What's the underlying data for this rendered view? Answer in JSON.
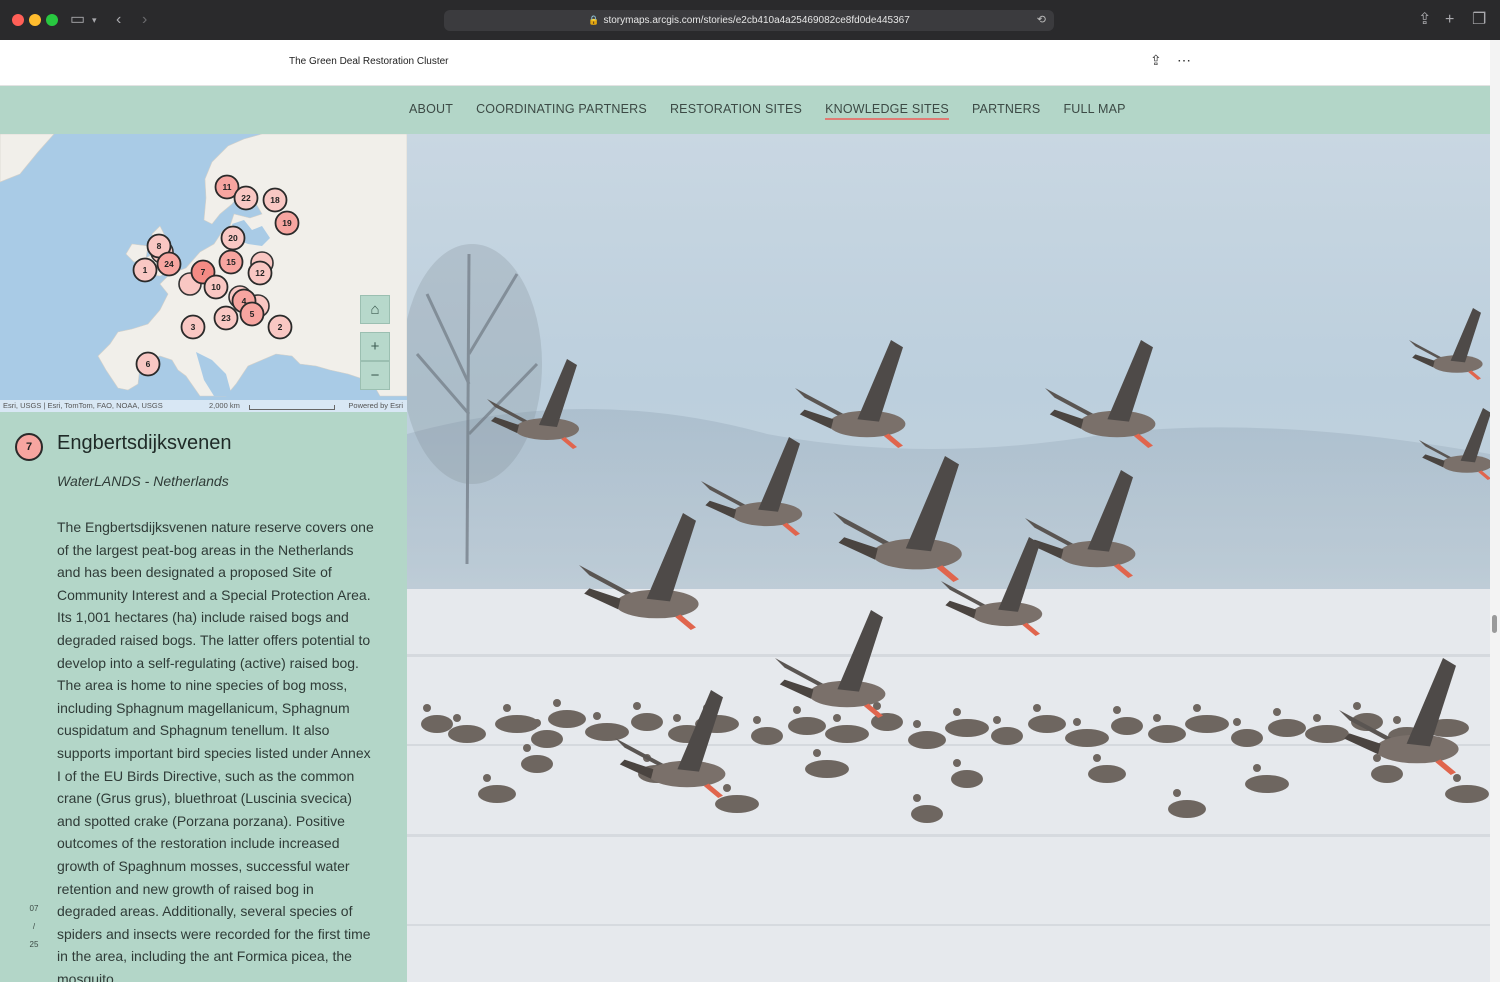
{
  "browser": {
    "url": "storymaps.arcgis.com/stories/e2cb410a4a25469082ce8fd0de445367"
  },
  "header": {
    "title": "The Green Deal Restoration Cluster"
  },
  "nav": {
    "items": [
      "ABOUT",
      "COORDINATING PARTNERS",
      "RESTORATION SITES",
      "KNOWLEDGE SITES",
      "PARTNERS",
      "FULL MAP"
    ],
    "active_index": 3
  },
  "map": {
    "markers": [
      "11",
      "22",
      "18",
      "19",
      "20",
      "8",
      "24",
      "1",
      "7",
      "15",
      "12",
      "10",
      "4",
      "3",
      "23",
      "5",
      "2",
      "6"
    ],
    "attribution_left": "Esri, USGS | Esri, TomTom, FAO, NOAA, USGS",
    "scale_label": "2,000 km",
    "attribution_right": "Powered by Esri",
    "controls": {
      "home": "⌂",
      "zoom_in": "+",
      "zoom_out": "−"
    }
  },
  "site": {
    "number": "7",
    "name": "Engbertsdijksvenen",
    "subtitle": "WaterLANDS - Netherlands",
    "body": "The Engbertsdijksvenen nature reserve covers one of the largest peat-bog areas in the Netherlands and has been designated a proposed Site of Community Interest and a Special Protection Area. Its 1,001 hectares (ha) include raised bogs and degraded raised bogs. The latter offers potential to develop into a self-regulating (active) raised bog. The area is home to nine species of bog moss, including Sphagnum magellanicum, Sphagnum cuspidatum and Sphagnum tenellum. It also supports important bird species listed under Annex I of the EU Birds Directive, such as the common crane (Grus grus), bluethroat (Luscinia svecica) and spotted crake (Porzana porzana). Positive outcomes of the restoration include increased growth of Spaghnum mosses, successful water retention and new growth of raised bog in degraded areas. Additionally, several species of spiders and insects were recorded for the first time in the area, including the ant Formica picea, the mosquito"
  },
  "pager": {
    "current": "07",
    "sep": "/",
    "total": "25"
  },
  "colors": {
    "nav_bg": "#b3d6c8",
    "marker_fill": "#f7a5a0",
    "active_underline": "#e07b74"
  }
}
